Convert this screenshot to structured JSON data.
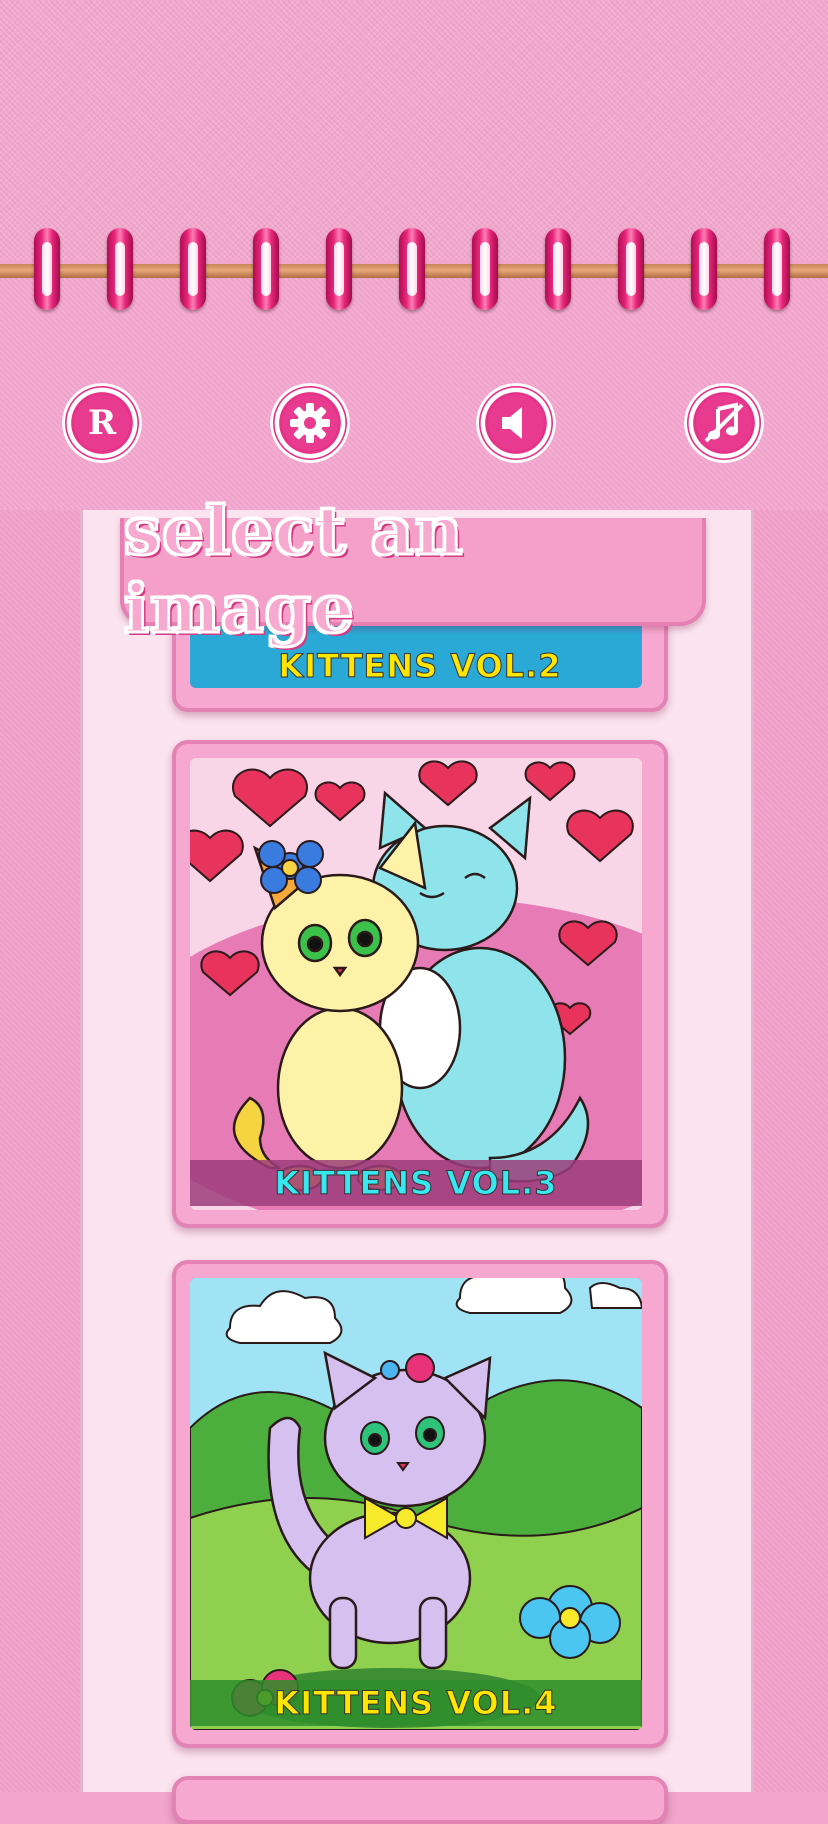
{
  "header": {
    "buttons": [
      {
        "name": "restore-button",
        "glyph": "R",
        "icon": "restore-icon"
      },
      {
        "name": "settings-button",
        "glyph": "⚙",
        "icon": "gear-icon"
      },
      {
        "name": "sound-button",
        "glyph": "◀",
        "icon": "speaker-icon"
      },
      {
        "name": "music-button",
        "glyph": "♬",
        "icon": "music-muted-icon"
      }
    ]
  },
  "title": "select an image",
  "cards": [
    {
      "label": "KITTENS VOL.2",
      "label_color": "#ffe600",
      "band_color": "#2aa9d6"
    },
    {
      "label": "KITTENS VOL.3",
      "label_color": "#38e8f0",
      "band_color": "#9c3d7a"
    },
    {
      "label": "KITTENS VOL.4",
      "label_color": "#ffe600",
      "band_color": "#2f8e2b"
    }
  ],
  "colors": {
    "accent": "#e6338a",
    "background": "#f5a9cf"
  }
}
